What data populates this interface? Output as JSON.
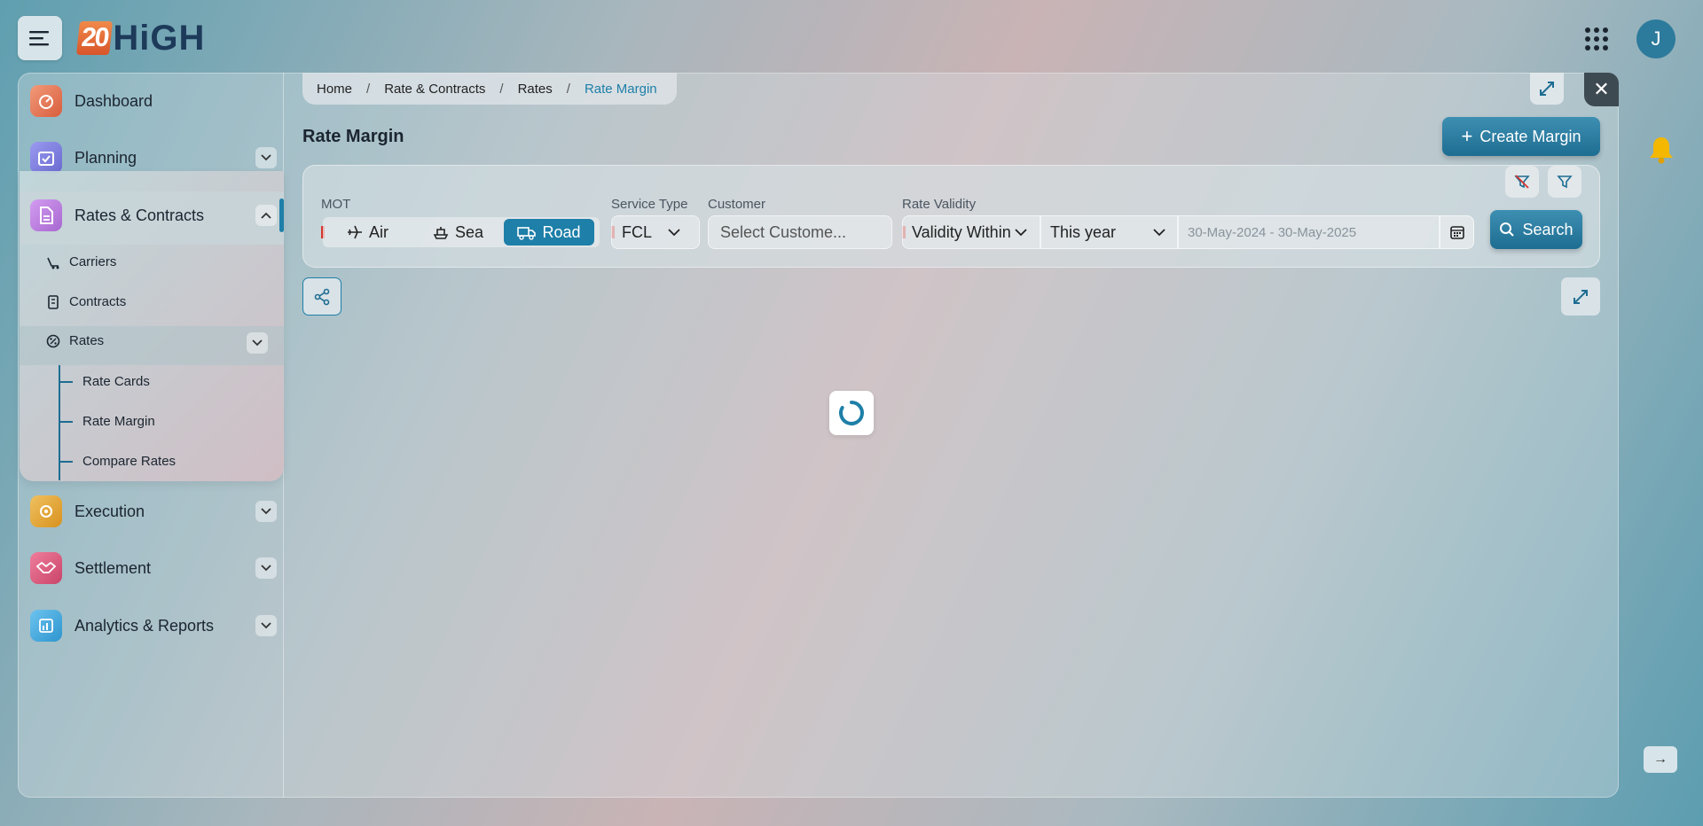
{
  "header": {
    "logo_number": "20",
    "logo_text": "HiGH",
    "avatar_initial": "J"
  },
  "sidebar": {
    "items": [
      {
        "label": "Dashboard",
        "icon": "dashboard-icon",
        "color": "#e8775a"
      },
      {
        "label": "Planning",
        "icon": "calendar-check-icon",
        "color": "#7d7de0"
      },
      {
        "label": "Rates & Contracts",
        "icon": "document-icon",
        "color": "#b77ad9"
      },
      {
        "label": "Execution",
        "icon": "execution-gear-icon",
        "color": "#e3a23a"
      },
      {
        "label": "Settlement",
        "icon": "handshake-icon",
        "color": "#d9577a"
      },
      {
        "label": "Analytics & Reports",
        "icon": "report-icon",
        "color": "#3ba6d9"
      }
    ],
    "submenu": {
      "carriers": "Carriers",
      "contracts": "Contracts",
      "rates": "Rates",
      "rate_cards": "Rate Cards",
      "rate_margin": "Rate Margin",
      "compare_rates": "Compare Rates"
    }
  },
  "breadcrumb": [
    "Home",
    "Rate & Contracts",
    "Rates",
    "Rate Margin"
  ],
  "page": {
    "title": "Rate Margin",
    "create_label": "Create Margin"
  },
  "filters": {
    "mot_label": "MOT",
    "mot_options": [
      "Air",
      "Sea",
      "Road"
    ],
    "mot_selected": "Road",
    "service_type_label": "Service Type",
    "service_type_value": "FCL",
    "customer_label": "Customer",
    "customer_placeholder": "Select Custome...",
    "rate_validity_label": "Rate Validity",
    "validity_mode": "Validity Within",
    "validity_period": "This year",
    "date_range_placeholder": "30-May-2024 - 30-May-2025",
    "search_label": "Search"
  },
  "colors": {
    "accent": "#1e7fa8",
    "required": "#d9342b",
    "bell": "#f5b800"
  }
}
